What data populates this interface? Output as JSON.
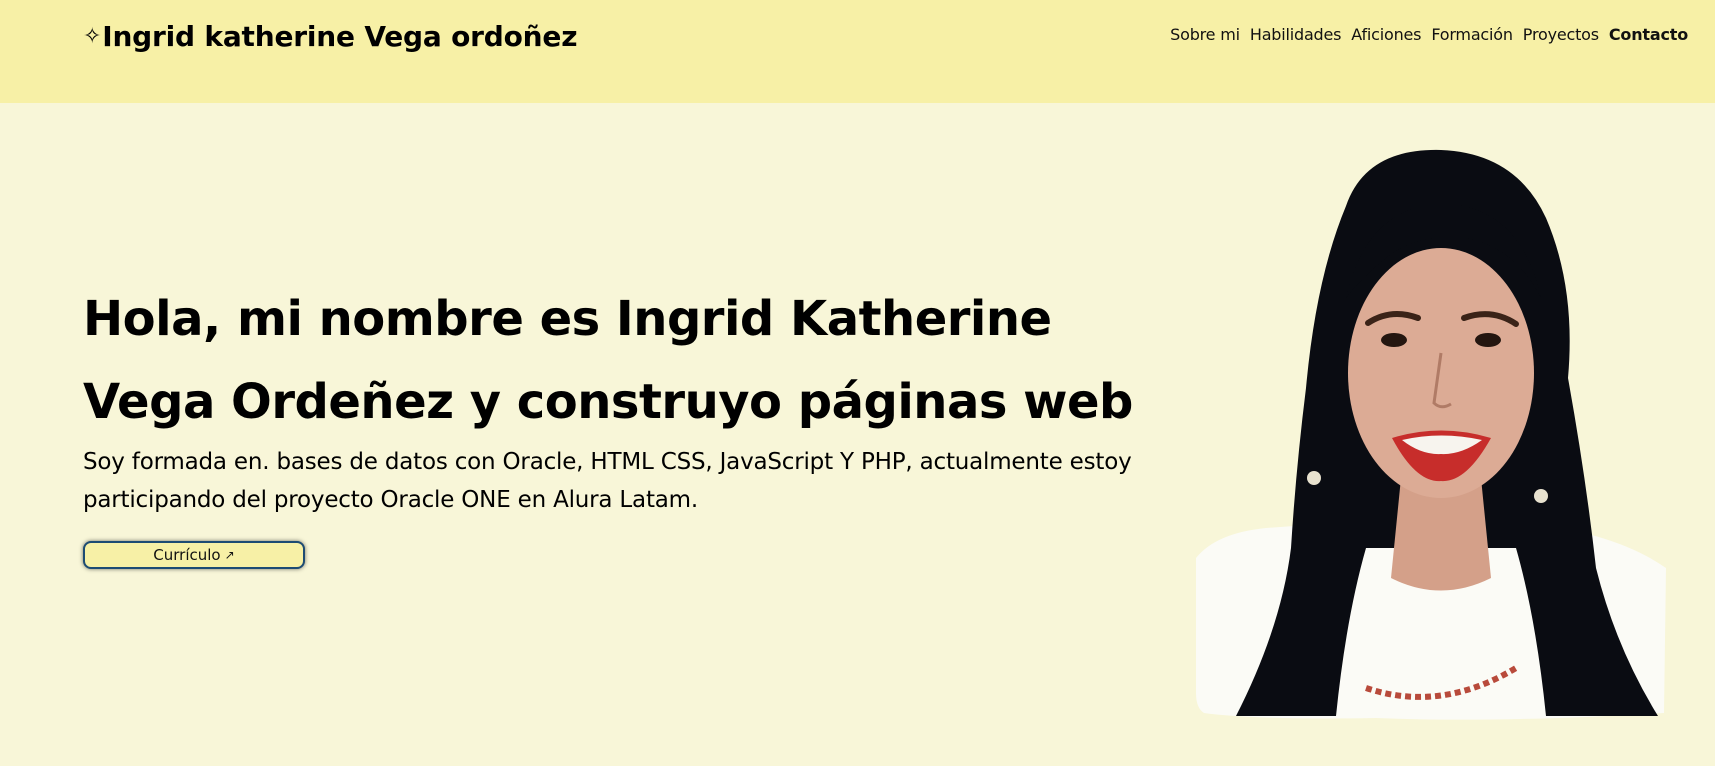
{
  "header": {
    "brand_icon": "sparkle-icon",
    "brand_glyph": "✧",
    "brand_name": "Ingrid katherine Vega ordoñez",
    "background": "#f7f0a6"
  },
  "nav": {
    "items": [
      {
        "label": "Sobre mi"
      },
      {
        "label": "Habilidades"
      },
      {
        "label": "Aficiones"
      },
      {
        "label": "Formación"
      },
      {
        "label": "Proyectos"
      },
      {
        "label": "Contacto",
        "active": true
      }
    ]
  },
  "hero": {
    "title": "Hola, mi nombre es Ingrid Katherine Vega Ordeñez y construyo páginas web",
    "description": "Soy formada en. bases de datos con Oracle, HTML CSS, JavaScript Y PHP, actualmente estoy participando del proyecto Oracle ONE en Alura Latam.",
    "cv_button_label": "Currículo",
    "cv_button_icon": "arrow-up-right-icon",
    "cv_button_glyph": "↗"
  },
  "colors": {
    "page_background": "#f8f6d8",
    "header_background": "#f7f0a6",
    "button_border": "#1d4b73",
    "text": "#000000"
  }
}
